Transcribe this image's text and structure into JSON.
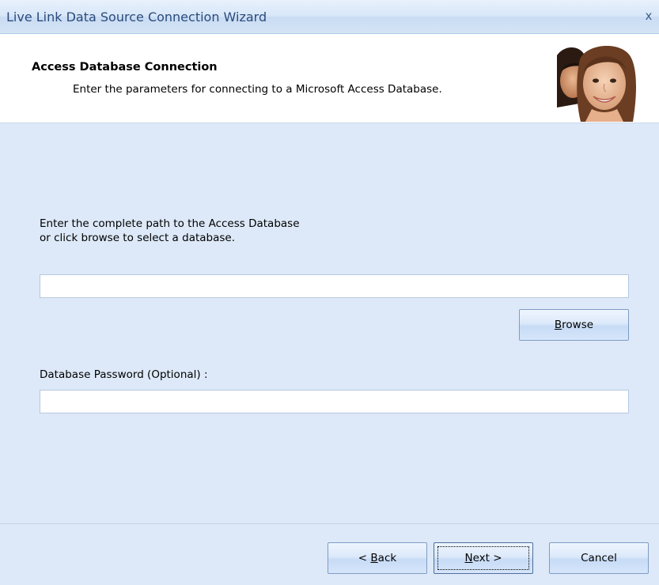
{
  "window": {
    "title": "Live Link Data Source Connection Wizard",
    "close_glyph": "x"
  },
  "header": {
    "title": "Access Database Connection",
    "subtitle": "Enter the parameters for connecting to a Microsoft Access Database."
  },
  "form": {
    "instruction_line1": "Enter the complete path to the Access Database",
    "instruction_line2": "or click browse to select a database.",
    "path_value": "",
    "browse_label_mnemonic": "B",
    "browse_label_rest": "rowse",
    "password_label": "Database Password (Optional) :",
    "password_value": ""
  },
  "footer": {
    "back_prefix": "< ",
    "back_mnemonic": "B",
    "back_rest": "ack",
    "next_mnemonic": "N",
    "next_rest": "ext >",
    "cancel_label": "Cancel"
  },
  "colors": {
    "content_background": "#dde9f8",
    "title_text": "#2a4b7c",
    "button_border": "#7f9cc4"
  },
  "icons": {
    "header_photo": "people-photo-icon",
    "close": "close-icon"
  }
}
